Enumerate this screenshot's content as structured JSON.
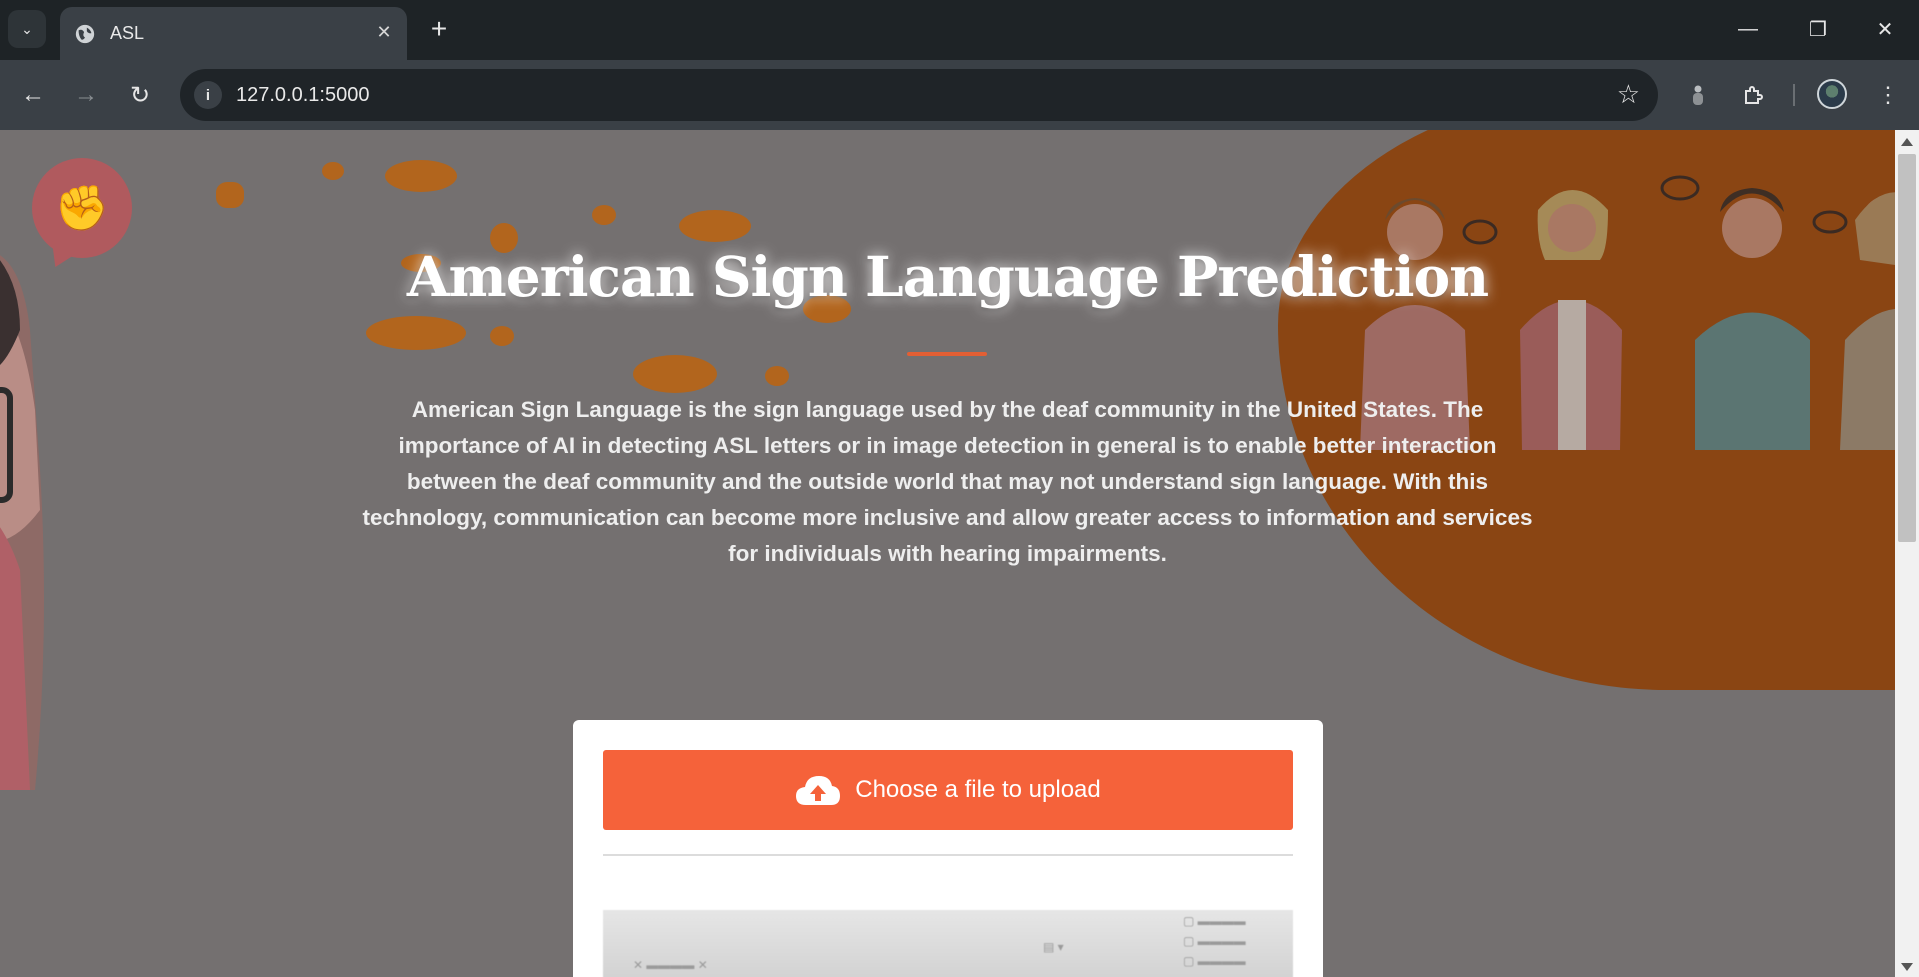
{
  "browser": {
    "tab_title": "ASL",
    "tab_close_glyph": "✕",
    "new_tab_glyph": "+",
    "url": "127.0.0.1:5000",
    "window_controls": {
      "minimize": "—",
      "restore": "❐",
      "close": "✕"
    },
    "icons": [
      "tab-search-icon",
      "globe-icon",
      "back-icon",
      "forward-icon",
      "reload-icon",
      "site-info-icon",
      "bookmark-star-icon",
      "tracking-icon",
      "extensions-icon",
      "profile-avatar",
      "more-menu-icon"
    ]
  },
  "page": {
    "title": "American Sign Language Prediction",
    "description": "American Sign Language is the sign language used by the deaf community in the United States. The importance of AI in detecting ASL letters or in image detection in general is to enable better interaction between the deaf community and the outside world that may not understand sign language. With this technology, communication can become more inclusive and allow greater access to information and services for individuals with hearing impairments.",
    "upload": {
      "label": "Choose a file to upload",
      "icon": "cloud-upload-icon"
    }
  },
  "colors": {
    "accent": "#f5623a",
    "blob": "#8a4513",
    "overlay_bg": "#747070",
    "chrome_dark": "#1e2326",
    "chrome_mid": "#3a4046"
  }
}
